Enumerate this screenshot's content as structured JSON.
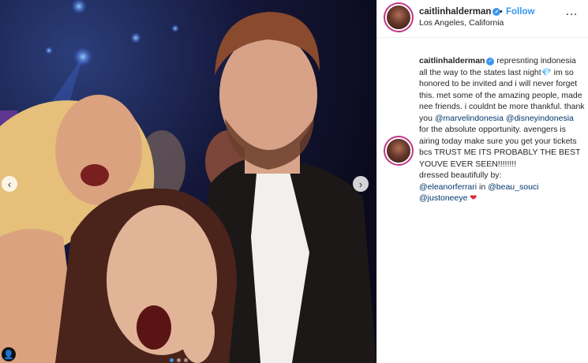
{
  "post": {
    "username": "caitlinhalderman",
    "bullet": "•",
    "follow_label": "Follow",
    "location": "Los Angeles, California",
    "more_icon": "…"
  },
  "caption": {
    "username": "caitlinhalderman",
    "text1": "represnting indonesia all the way to the states last night",
    "text2": " im so honored to be invited and i will never forget this. met some of the amazing people, made nee friends. i couldnt be more thankful. thank you ",
    "mention1": "@marvelindonesia",
    "mention2": "@disneyindonesia",
    "text3": " for the absolute opportunity. avengers is airing today make sure you get your tickets bcs TRUST ME ITS PROBABLY THE BEST YOUVE EVER SEEN!!!!!!!!",
    "text4": "dressed beautifully by:",
    "mention3": "@eleanorferrari",
    "text5": " in ",
    "mention4": "@beau_souci",
    "mention5": "@justoneeye",
    "gem_emoji": "💎",
    "heart_emoji": "❤"
  },
  "carousel": {
    "prev_icon": "‹",
    "next_icon": "›",
    "tag_icon": "person-tag-icon",
    "tag_glyph": "👤",
    "active_slide": 1,
    "slides": 3
  },
  "colors": {
    "accent": "#3897f0",
    "mention": "#00376b",
    "text": "#262626"
  }
}
